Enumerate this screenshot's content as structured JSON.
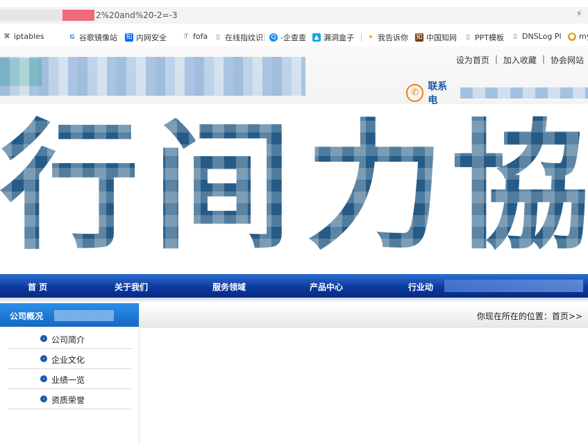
{
  "address_bar": {
    "url_tail": "2%20and%20-2=-3"
  },
  "bookmarks": [
    {
      "label": "iptables",
      "icon": "command-icon"
    },
    {
      "label": "谷歌镜像站",
      "icon": "google-icon"
    },
    {
      "label": "内网安全",
      "icon": "zhihu-icon"
    },
    {
      "label": "fofa",
      "icon": "fofa-icon"
    },
    {
      "label": "在线指纹识",
      "icon": "document-icon"
    },
    {
      "label": "-企查查",
      "icon": "qcc-icon"
    },
    {
      "label": "漏洞盒子",
      "icon": "vulbox-icon"
    },
    {
      "label": "我告诉你",
      "icon": "msdn-icon"
    },
    {
      "label": "中国知网",
      "icon": "cnki-icon"
    },
    {
      "label": "PPT模板",
      "icon": "document-icon"
    },
    {
      "label": "DNSLog Pl",
      "icon": "document-icon"
    },
    {
      "label": "my",
      "icon": "my-icon"
    }
  ],
  "header": {
    "links": [
      "设为首页",
      "加入收藏",
      "协会网站"
    ],
    "separator": "|",
    "contact_label": "联系电"
  },
  "banner": {
    "characters": [
      "行",
      "间",
      "力",
      "協"
    ]
  },
  "nav": {
    "items": [
      "首 页",
      "关于我们",
      "服务领域",
      "产品中心",
      "行业动"
    ]
  },
  "sidebar": {
    "title": "公司概况",
    "items": [
      "公司简介",
      "企业文化",
      "业绩一览",
      "资质荣誉"
    ]
  },
  "main": {
    "breadcrumb": "你现在所在的位置：首页>>"
  },
  "colors": {
    "nav_blue": "#0d3aa0",
    "accent_orange": "#f08300",
    "sidebar_blue": "#1569c4"
  }
}
